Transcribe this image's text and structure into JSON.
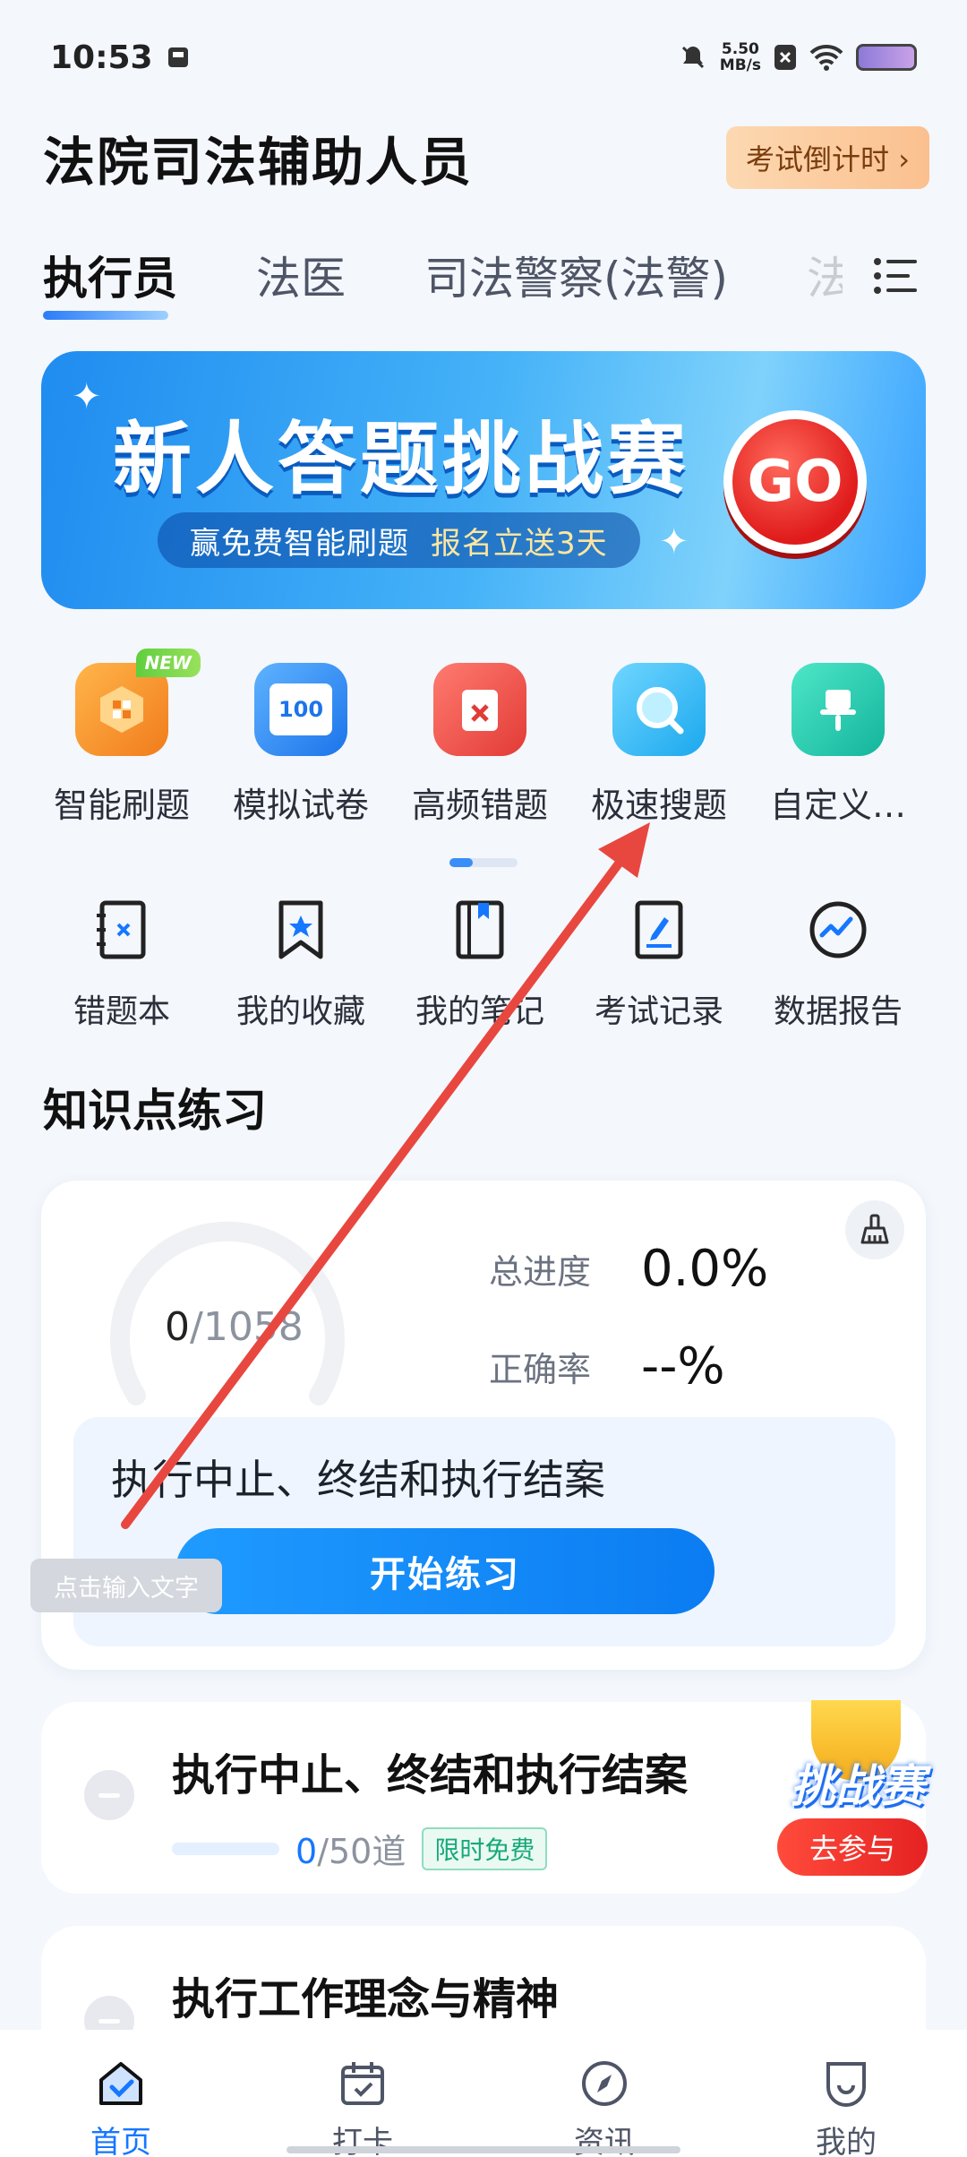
{
  "status_bar": {
    "time": "10:53",
    "net_speed_value": "5.50",
    "net_speed_unit": "MB/s"
  },
  "header": {
    "title": "法院司法辅助人员",
    "countdown_label": "考试倒计时 ›"
  },
  "tabs": [
    {
      "label": "执行员",
      "active": true
    },
    {
      "label": "法医"
    },
    {
      "label": "司法警察(法警)"
    },
    {
      "label": "法"
    }
  ],
  "banner": {
    "title": "新人答题挑战赛",
    "subtitle_a": "赢免费智能刷题",
    "subtitle_b": "报名立送3天",
    "go": "GO"
  },
  "features": [
    {
      "label": "智能刷题",
      "icon": "smart-practice-icon",
      "badge": "NEW",
      "color": "#f79a2b"
    },
    {
      "label": "模拟试卷",
      "icon": "mock-exam-icon",
      "badge_text": "100",
      "color": "#2f8ef5"
    },
    {
      "label": "高频错题",
      "icon": "frequent-errors-icon",
      "color": "#f2514d"
    },
    {
      "label": "极速搜题",
      "icon": "quick-search-icon",
      "color": "#27b7f2"
    },
    {
      "label": "自定义…",
      "icon": "custom-pin-icon",
      "color": "#1fc9b4"
    }
  ],
  "tools": [
    {
      "label": "错题本",
      "icon": "wrong-book-icon"
    },
    {
      "label": "我的收藏",
      "icon": "bookmark-icon"
    },
    {
      "label": "我的笔记",
      "icon": "notes-icon"
    },
    {
      "label": "考试记录",
      "icon": "exam-record-icon"
    },
    {
      "label": "数据报告",
      "icon": "data-report-icon"
    }
  ],
  "knowledge": {
    "section_title": "知识点练习",
    "done": "0",
    "total": "/1058",
    "progress_label": "总进度",
    "progress_value": "0.0%",
    "accuracy_label": "正确率",
    "accuracy_value": "--%",
    "current_topic": "执行中止、终结和执行结案",
    "start_button": "开始练习",
    "input_hint": "点击输入文字"
  },
  "topics": [
    {
      "title": "执行中止、终结和执行结案",
      "done": "0",
      "total": "/50道",
      "badge": "限时免费"
    },
    {
      "title": "执行工作理念与精神"
    }
  ],
  "challenge_badge": {
    "title": "挑战赛",
    "button": "去参与"
  },
  "bottom_nav": [
    {
      "label": "首页",
      "icon": "home-icon",
      "active": true
    },
    {
      "label": "打卡",
      "icon": "checkin-icon"
    },
    {
      "label": "资讯",
      "icon": "news-compass-icon"
    },
    {
      "label": "我的",
      "icon": "profile-icon"
    }
  ],
  "colors": {
    "accent": "#1677ff",
    "annotation_arrow": "#e8473f"
  }
}
